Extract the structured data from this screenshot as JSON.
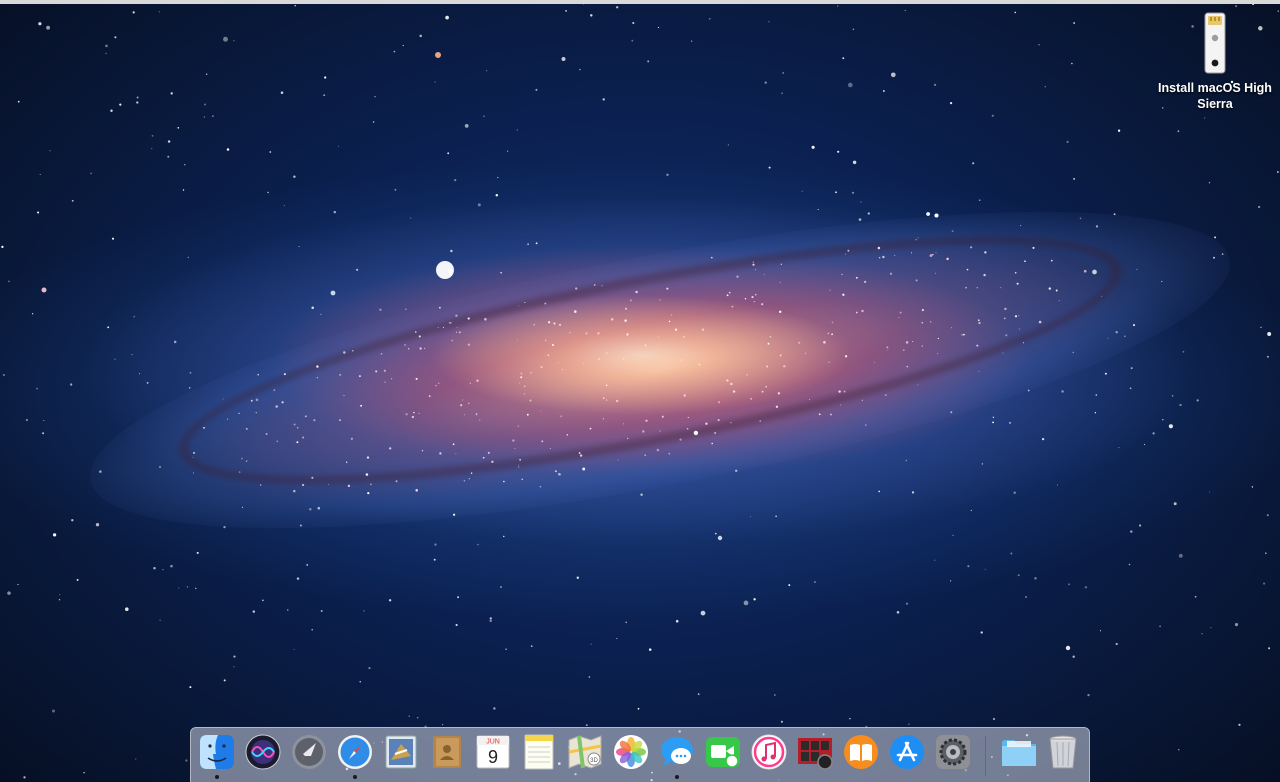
{
  "desktop": {
    "wallpaper": "andromeda-galaxy",
    "icons": [
      {
        "label": "Install macOS High Sierra",
        "icon": "usb-drive-icon"
      }
    ]
  },
  "dock": {
    "apps": [
      {
        "name": "Finder",
        "icon": "finder-icon",
        "running": true
      },
      {
        "name": "Siri",
        "icon": "siri-icon",
        "running": false
      },
      {
        "name": "Launchpad",
        "icon": "launchpad-icon",
        "running": false
      },
      {
        "name": "Safari",
        "icon": "safari-icon",
        "running": true
      },
      {
        "name": "Mail",
        "icon": "mail-icon",
        "running": false
      },
      {
        "name": "Contacts",
        "icon": "contacts-icon",
        "running": false
      },
      {
        "name": "Calendar",
        "icon": "calendar-icon",
        "running": false,
        "month": "JUN",
        "day": "9"
      },
      {
        "name": "Notes",
        "icon": "notes-icon",
        "running": false
      },
      {
        "name": "Maps",
        "icon": "maps-icon",
        "running": false
      },
      {
        "name": "Photos",
        "icon": "photos-icon",
        "running": false
      },
      {
        "name": "Messages",
        "icon": "messages-icon",
        "running": true
      },
      {
        "name": "FaceTime",
        "icon": "facetime-icon",
        "running": false
      },
      {
        "name": "iTunes",
        "icon": "itunes-icon",
        "running": false
      },
      {
        "name": "Photo Booth",
        "icon": "photo-booth-icon",
        "running": false
      },
      {
        "name": "iBooks",
        "icon": "ibooks-icon",
        "running": false
      },
      {
        "name": "App Store",
        "icon": "app-store-icon",
        "running": false
      },
      {
        "name": "System Preferences",
        "icon": "system-preferences-icon",
        "running": false
      }
    ],
    "extras": [
      {
        "name": "Downloads",
        "icon": "folder-icon"
      },
      {
        "name": "Trash",
        "icon": "trash-icon"
      }
    ]
  },
  "colors": {
    "space": "#0b2050",
    "galaxy_core": "#fbe3cc",
    "dock_background": "#cdd4e1"
  }
}
